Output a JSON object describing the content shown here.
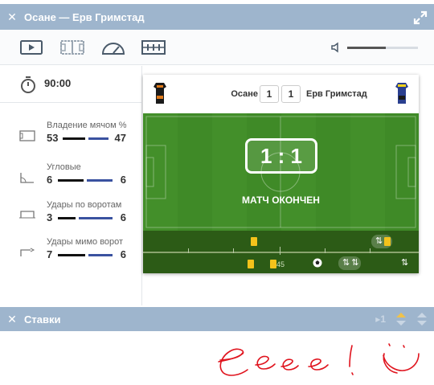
{
  "window": {
    "title": "Осане — Ерв Гримстад"
  },
  "toolbar": {
    "icons": [
      "play-icon",
      "pitch-icon",
      "speedometer-icon",
      "lineup-icon"
    ],
    "volume": 0.55
  },
  "timer": {
    "value": "90:00"
  },
  "stats": [
    {
      "label": "Владение мячом %",
      "home": "53",
      "away": "47",
      "icon": "field-icon"
    },
    {
      "label": "Угловые",
      "home": "6",
      "away": "6",
      "icon": "corner-icon"
    },
    {
      "label": "Удары по воротам",
      "home": "3",
      "away": "6",
      "icon": "goal-icon"
    },
    {
      "label": "Удары мимо ворот",
      "home": "7",
      "away": "6",
      "icon": "shot-off-icon"
    }
  ],
  "match": {
    "home": "Осане",
    "away": "Ерв Гримстад",
    "home_score": "1",
    "away_score": "1",
    "big_score": "1 : 1",
    "status": "МАТЧ ОКОНЧЕН",
    "timeline_label": "45",
    "colors": {
      "pitch": "#3f8a27",
      "timeline": "#2c5b16",
      "card": "#f4c21b"
    }
  },
  "bets": {
    "title": "Ставки",
    "counter": "1"
  },
  "annotation": {
    "text": "eeee ! :)"
  },
  "colors": {
    "titlebar": "#9eb5cd",
    "away_bar": "#3a52a0",
    "home_bar": "#111111",
    "scribble": "#e0141e"
  }
}
